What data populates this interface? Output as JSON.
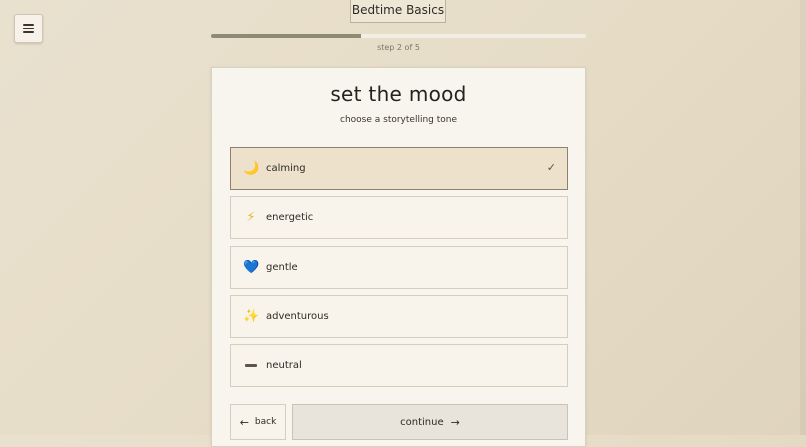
{
  "app": {
    "title": "Bedtime Basics"
  },
  "progress": {
    "step_text": "step 2 of 5",
    "fraction": 0.4
  },
  "wizard": {
    "heading": "set the mood",
    "subheading": "choose a storytelling tone",
    "options": [
      {
        "label": "calming",
        "icon": "crescent-moon-icon",
        "glyph": "🌙",
        "selected": true
      },
      {
        "label": "energetic",
        "icon": "lightning-icon",
        "glyph": "⚡",
        "selected": false
      },
      {
        "label": "gentle",
        "icon": "blue-heart-icon",
        "glyph": "💙",
        "selected": false
      },
      {
        "label": "adventurous",
        "icon": "sparkles-icon",
        "glyph": "✨",
        "selected": false
      },
      {
        "label": "neutral",
        "icon": "minus-icon",
        "glyph": "",
        "selected": false
      }
    ],
    "back_label": "back",
    "continue_label": "continue"
  },
  "colors": {
    "background": "#e7dfcc",
    "selected_option": "#eee1cc",
    "progress_fill": "#8e8b74"
  }
}
